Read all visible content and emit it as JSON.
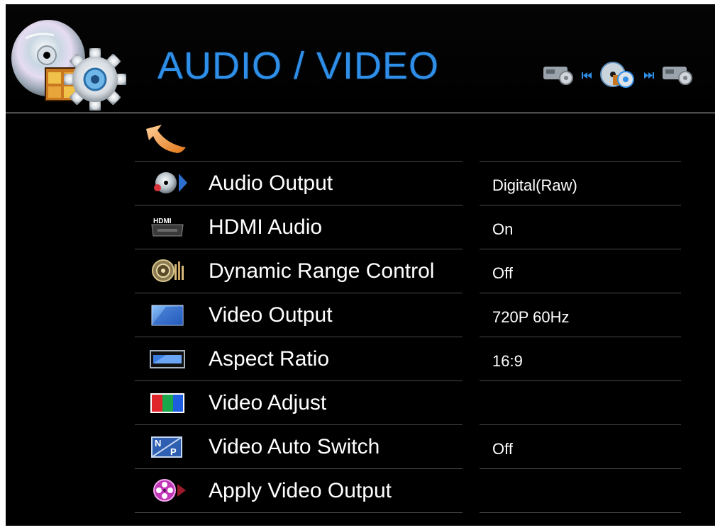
{
  "header": {
    "title": "AUDIO / VIDEO",
    "nav": {
      "prev_icon": "projector-gear-icon",
      "current_icon": "disc-gear-icon",
      "next_icon": "projector-gear-icon"
    }
  },
  "back_icon": "back-arrow-icon",
  "menu": [
    {
      "label": "Audio Output",
      "value": "Digital(Raw)",
      "icon": "audio-output-icon"
    },
    {
      "label": "HDMI Audio",
      "value": "On",
      "icon": "hdmi-icon"
    },
    {
      "label": "Dynamic Range Control",
      "value": "Off",
      "icon": "speaker-icon"
    },
    {
      "label": "Video Output",
      "value": "720P 60Hz",
      "icon": "video-output-icon"
    },
    {
      "label": "Aspect Ratio",
      "value": "16:9",
      "icon": "aspect-ratio-icon"
    },
    {
      "label": "Video Adjust",
      "value": "",
      "icon": "rgb-icon"
    },
    {
      "label": "Video Auto Switch",
      "value": "Off",
      "icon": "ntsc-pal-icon"
    },
    {
      "label": "Apply Video Output",
      "value": "",
      "icon": "film-reel-icon"
    }
  ],
  "colors": {
    "title": "#2f8fe8",
    "background": "#000000",
    "text": "#ffffff",
    "separator": "#4a4a4a"
  }
}
